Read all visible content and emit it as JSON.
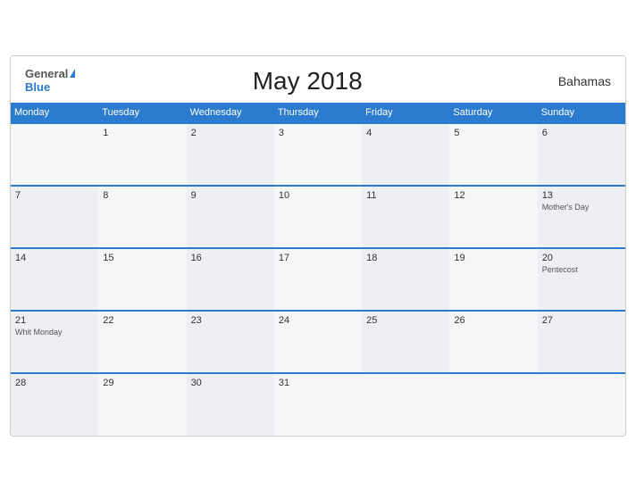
{
  "header": {
    "title": "May 2018",
    "country": "Bahamas",
    "logo_general": "General",
    "logo_blue": "Blue"
  },
  "weekdays": [
    "Monday",
    "Tuesday",
    "Wednesday",
    "Thursday",
    "Friday",
    "Saturday",
    "Sunday"
  ],
  "weeks": [
    [
      {
        "day": "",
        "event": ""
      },
      {
        "day": "1",
        "event": ""
      },
      {
        "day": "2",
        "event": ""
      },
      {
        "day": "3",
        "event": ""
      },
      {
        "day": "4",
        "event": ""
      },
      {
        "day": "5",
        "event": ""
      },
      {
        "day": "6",
        "event": ""
      }
    ],
    [
      {
        "day": "7",
        "event": ""
      },
      {
        "day": "8",
        "event": ""
      },
      {
        "day": "9",
        "event": ""
      },
      {
        "day": "10",
        "event": ""
      },
      {
        "day": "11",
        "event": ""
      },
      {
        "day": "12",
        "event": ""
      },
      {
        "day": "13",
        "event": "Mother's Day"
      }
    ],
    [
      {
        "day": "14",
        "event": ""
      },
      {
        "day": "15",
        "event": ""
      },
      {
        "day": "16",
        "event": ""
      },
      {
        "day": "17",
        "event": ""
      },
      {
        "day": "18",
        "event": ""
      },
      {
        "day": "19",
        "event": ""
      },
      {
        "day": "20",
        "event": "Pentecost"
      }
    ],
    [
      {
        "day": "21",
        "event": "Whit Monday"
      },
      {
        "day": "22",
        "event": ""
      },
      {
        "day": "23",
        "event": ""
      },
      {
        "day": "24",
        "event": ""
      },
      {
        "day": "25",
        "event": ""
      },
      {
        "day": "26",
        "event": ""
      },
      {
        "day": "27",
        "event": ""
      }
    ],
    [
      {
        "day": "28",
        "event": ""
      },
      {
        "day": "29",
        "event": ""
      },
      {
        "day": "30",
        "event": ""
      },
      {
        "day": "31",
        "event": ""
      },
      {
        "day": "",
        "event": ""
      },
      {
        "day": "",
        "event": ""
      },
      {
        "day": "",
        "event": ""
      }
    ]
  ]
}
